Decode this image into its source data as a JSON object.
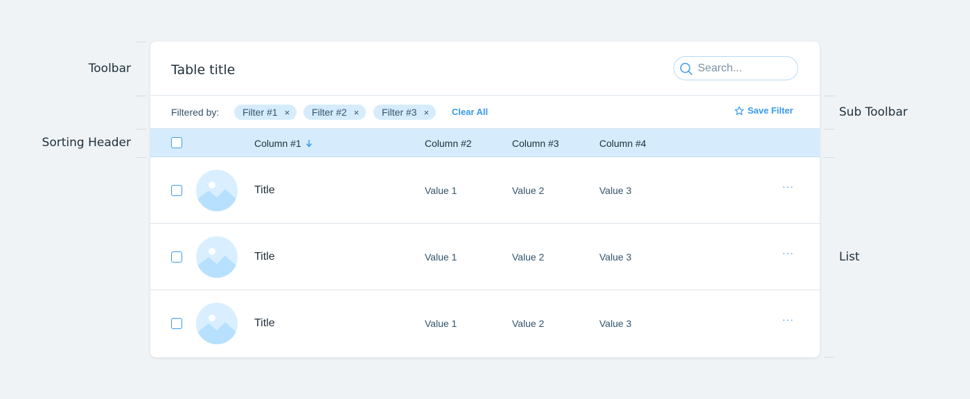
{
  "annotations": {
    "toolbar": "Toolbar",
    "sub_toolbar": "Sub Toolbar",
    "sorting_header": "Sorting Header",
    "list": "List"
  },
  "toolbar": {
    "title": "Table title",
    "search": {
      "placeholder": "Search...",
      "value": "",
      "icon": "search-icon"
    }
  },
  "sub_toolbar": {
    "filtered_by": "Filtered by:",
    "filters": [
      {
        "label": "Filter #1",
        "remove": "×"
      },
      {
        "label": "Filter #2",
        "remove": "×"
      },
      {
        "label": "Filter #3",
        "remove": "×"
      }
    ],
    "clear_all": "Clear All",
    "save_filter": "Save Filter",
    "save_filter_icon": "star-icon"
  },
  "sorting_header": {
    "columns": [
      "Column #1",
      "Column #2",
      "Column #3",
      "Column #4"
    ],
    "sorted_column": "Column #1",
    "sort_direction": "descending"
  },
  "list": {
    "rows": [
      {
        "title": "Title",
        "values": [
          "Value 1",
          "Value 2",
          "Value 3"
        ],
        "more": "···"
      },
      {
        "title": "Title",
        "values": [
          "Value 1",
          "Value 2",
          "Value 3"
        ],
        "more": "···"
      },
      {
        "title": "Title",
        "values": [
          "Value 1",
          "Value 2",
          "Value 3"
        ],
        "more": "···"
      }
    ]
  },
  "colors": {
    "accent": "#3899ec",
    "header_bg": "#d6ecfc",
    "page_bg": "#eff3f6",
    "text_dark": "#20303c",
    "text_muted": "#32536a"
  }
}
